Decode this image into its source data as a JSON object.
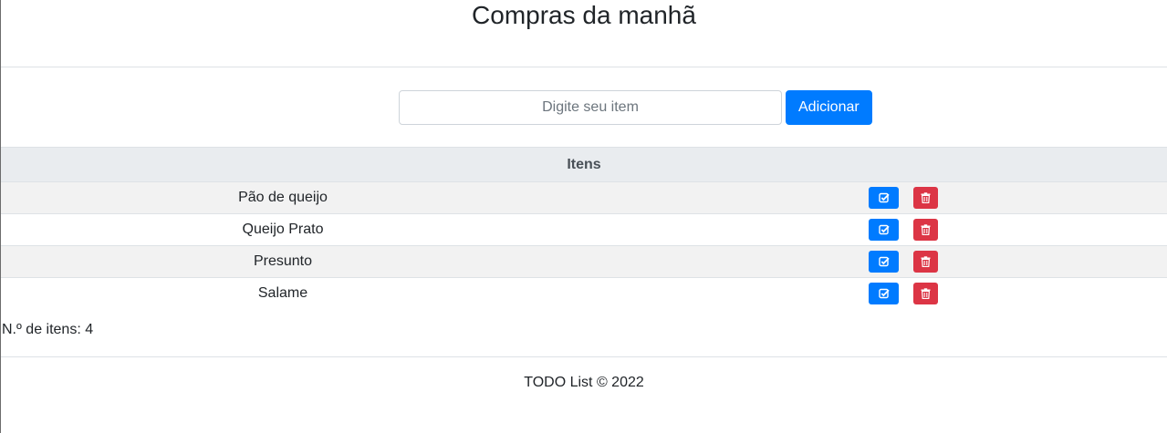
{
  "header": {
    "title": "Compras da manhã"
  },
  "form": {
    "placeholder": "Digite seu item",
    "value": "",
    "add_label": "Adicionar"
  },
  "table": {
    "header": "Itens",
    "rows": [
      {
        "name": "Pão de queijo"
      },
      {
        "name": "Queijo Prato"
      },
      {
        "name": "Presunto"
      },
      {
        "name": "Salame"
      }
    ]
  },
  "count": {
    "label": "N.º de itens:",
    "value": "4"
  },
  "footer": {
    "text": "TODO List © 2022"
  },
  "icons": {
    "edit": "check-square-icon",
    "delete": "trash-icon"
  },
  "colors": {
    "primary": "#007bff",
    "danger": "#dc3545",
    "table_header_bg": "#e9ecef",
    "stripe": "#f2f2f2"
  }
}
